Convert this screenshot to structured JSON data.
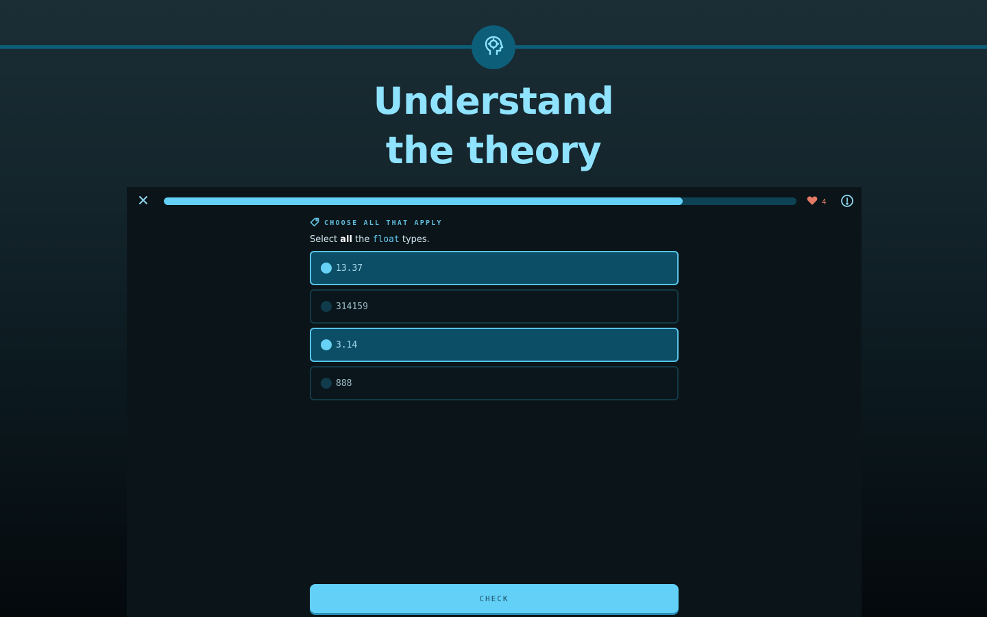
{
  "hero": {
    "title_line1": "Understand",
    "title_line2": "the theory",
    "badge_icon": "brain-head-icon"
  },
  "lesson": {
    "progress_percent": 82,
    "lives": "4",
    "question_type": "CHOOSE ALL THAT APPLY",
    "prompt": {
      "prefix": "Select",
      "emphasis": "all",
      "middle": "the",
      "code": "float",
      "suffix": "types."
    },
    "options": [
      {
        "label": "13.37",
        "selected": true
      },
      {
        "label": "314159",
        "selected": false
      },
      {
        "label": "3.14",
        "selected": true
      },
      {
        "label": "888",
        "selected": false
      }
    ],
    "check_label": "CHECK"
  },
  "colors": {
    "accent": "#63d0f5",
    "title": "#8fe3ff",
    "heart": "#e57a64"
  }
}
